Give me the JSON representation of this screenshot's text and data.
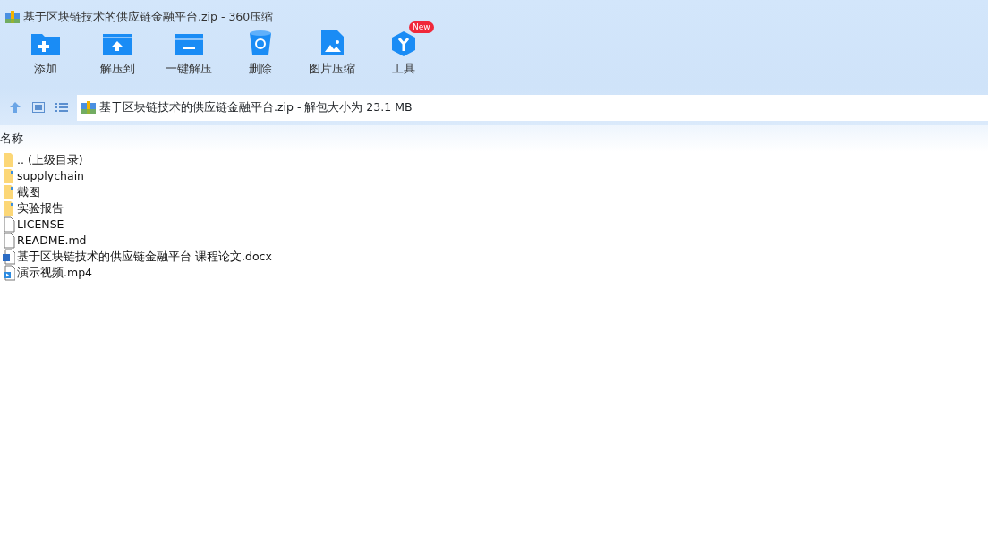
{
  "window": {
    "title": "基于区块链技术的供应链金融平台.zip - 360压缩"
  },
  "toolbar": [
    {
      "label": "添加",
      "kind": "add"
    },
    {
      "label": "解压到",
      "kind": "extract"
    },
    {
      "label": "一键解压",
      "kind": "oneclick"
    },
    {
      "label": "删除",
      "kind": "delete"
    },
    {
      "label": "图片压缩",
      "kind": "image"
    },
    {
      "label": "工具",
      "kind": "tools",
      "badge": "New"
    }
  ],
  "address": {
    "path": "基于区块链技术的供应链金融平台.zip - 解包大小为 23.1 MB"
  },
  "table": {
    "columns": [
      "名称"
    ],
    "rows": [
      {
        "name": ".. (上级目录)",
        "kind": "parent"
      },
      {
        "name": "supplychain",
        "kind": "folder"
      },
      {
        "name": "截图",
        "kind": "folder"
      },
      {
        "name": "实验报告",
        "kind": "folder"
      },
      {
        "name": "LICENSE",
        "kind": "file"
      },
      {
        "name": "README.md",
        "kind": "file"
      },
      {
        "name": "基于区块链技术的供应链金融平台 课程论文.docx",
        "kind": "word"
      },
      {
        "name": "演示视频.mp4",
        "kind": "video"
      }
    ]
  }
}
